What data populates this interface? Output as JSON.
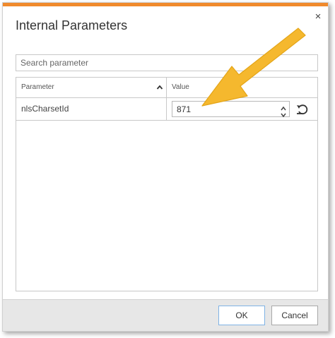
{
  "dialog": {
    "title": "Internal Parameters",
    "close_label": "×",
    "accent_color": "#f08a2c"
  },
  "search": {
    "placeholder": "Search parameter",
    "value": ""
  },
  "grid": {
    "columns": [
      {
        "label": "Parameter",
        "sorted": "ascending"
      },
      {
        "label": "Value"
      }
    ],
    "rows": [
      {
        "parameter": "nlsCharsetId",
        "value": "871"
      }
    ]
  },
  "icons": {
    "sort": "chevron-up-icon",
    "spinner_up": "spin-up-icon",
    "spinner_down": "spin-down-icon",
    "reset": "reset-icon",
    "annotation": "arrow-annotation"
  },
  "annotation_color": "#f5b82e",
  "footer": {
    "ok_label": "OK",
    "cancel_label": "Cancel"
  }
}
